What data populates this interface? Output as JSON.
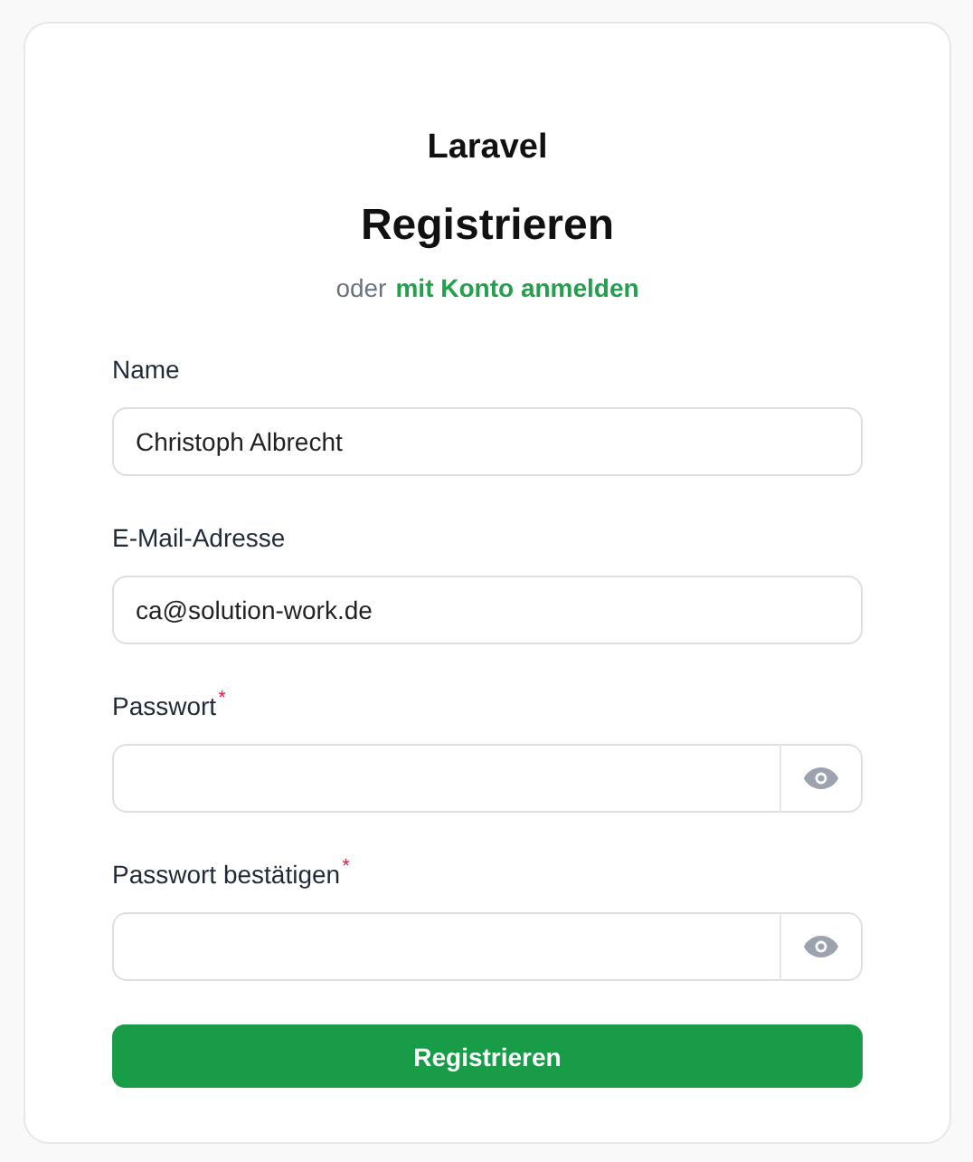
{
  "brand": "Laravel",
  "heading": "Registrieren",
  "subtitle": {
    "text": "oder",
    "link": "mit Konto anmelden"
  },
  "fields": [
    {
      "kind": "text",
      "label": "Name",
      "value": "Christoph Albrecht"
    },
    {
      "kind": "text",
      "label": "E-Mail-Adresse",
      "value": "ca@solution-work.de"
    },
    {
      "kind": "password",
      "label": "Passwort",
      "required_mark": "*"
    },
    {
      "kind": "password",
      "label": "Passwort bestätigen",
      "required_mark": "*"
    }
  ],
  "submit": "Registrieren"
}
